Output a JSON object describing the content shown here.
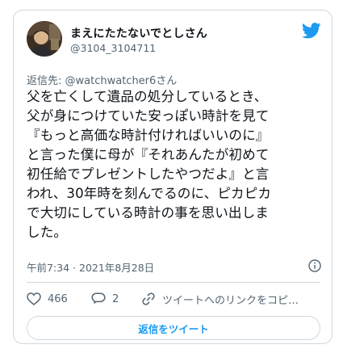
{
  "colors": {
    "accent": "#1d9bf0",
    "secondary_text": "#536471",
    "border": "#cfd9de",
    "like_icon": "#f91880",
    "twitter_bird": "#1d9bf0"
  },
  "tweet": {
    "author": {
      "display_name": "まえにたたないでとしさん",
      "handle": "@3104_3104711",
      "avatar_icon": "avatar-photo"
    },
    "reply_to": "返信先: @watchwatcher6さん",
    "text": "父を亡くして遺品の処分しているとき、\n父が身につけていた安っぽい時計を見て\n『もっと高価な時計付ければいいのに』\nと言った僕に母が『それあんたが初めて\n初任給でプレゼントしたやつだよ』と言\nわれ、30年時を刻んでるのに、ピカピカ\nで大切にしている時計の事を思い出しま\nした。",
    "timestamp": "午前7:34 · 2021年8月28日",
    "actions": {
      "like_count": "466",
      "reply_count": "2",
      "copy_link_label": "ツイートへのリンクをコピ…"
    },
    "reply_button_label": "返信をツイート"
  },
  "icons": {
    "brand": "twitter-bird-icon",
    "info": "info-icon",
    "like": "heart-icon",
    "reply": "reply-bubble-icon",
    "link": "link-icon"
  }
}
